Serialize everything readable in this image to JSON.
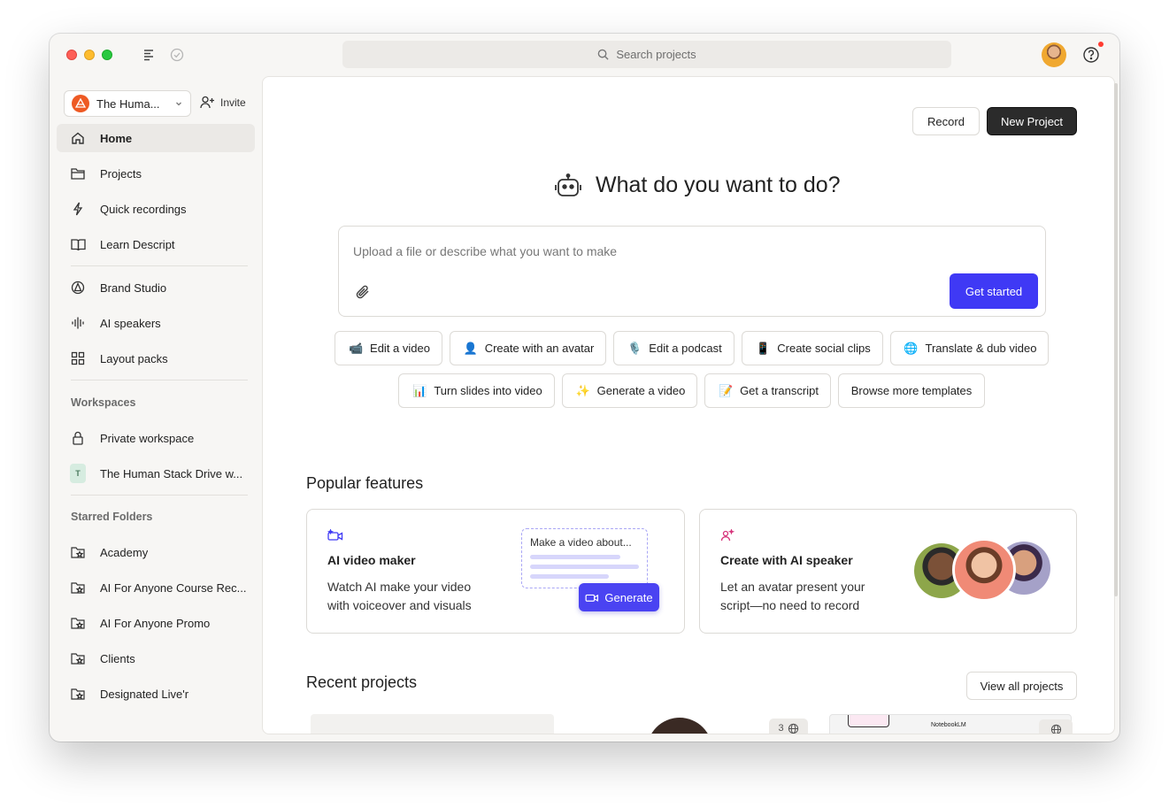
{
  "titlebar": {
    "search_placeholder": "Search projects"
  },
  "sidebar": {
    "workspace_name": "The Huma...",
    "invite_label": "Invite",
    "nav_items": [
      {
        "label": "Home",
        "icon": "home-icon",
        "active": true
      },
      {
        "label": "Projects",
        "icon": "folder-icon"
      },
      {
        "label": "Quick recordings",
        "icon": "lightning-icon"
      },
      {
        "label": "Learn Descript",
        "icon": "book-icon"
      }
    ],
    "tool_items": [
      {
        "label": "Brand Studio",
        "icon": "brand-icon"
      },
      {
        "label": "AI speakers",
        "icon": "waveform-icon"
      },
      {
        "label": "Layout packs",
        "icon": "grid-icon"
      }
    ],
    "workspaces_heading": "Workspaces",
    "workspaces": [
      {
        "label": "Private workspace",
        "icon": "lock-icon"
      },
      {
        "label": "The Human Stack Drive w...",
        "badge": "T"
      }
    ],
    "starred_heading": "Starred Folders",
    "starred": [
      {
        "label": "Academy"
      },
      {
        "label": "AI For Anyone Course Rec..."
      },
      {
        "label": "AI For Anyone Promo"
      },
      {
        "label": "Clients"
      },
      {
        "label": "Designated Live'r"
      }
    ]
  },
  "main": {
    "record_label": "Record",
    "new_project_label": "New Project",
    "hero_title": "What do you want to do?",
    "prompt_placeholder": "Upload a file or describe what you want to make",
    "get_started_label": "Get started",
    "chips_row1": [
      {
        "label": "Edit a video",
        "emoji": "📹"
      },
      {
        "label": "Create with an avatar",
        "emoji": "👤"
      },
      {
        "label": "Edit a podcast",
        "emoji": "🎙️"
      },
      {
        "label": "Create social clips",
        "emoji": "📱"
      },
      {
        "label": "Translate & dub video",
        "emoji": "🌐"
      }
    ],
    "chips_row2": [
      {
        "label": "Turn slides into video",
        "emoji": "📊"
      },
      {
        "label": "Generate a video",
        "emoji": "✨"
      },
      {
        "label": "Get a transcript",
        "emoji": "📝"
      },
      {
        "label": "Browse more templates",
        "emoji": ""
      }
    ],
    "popular_heading": "Popular features",
    "card1": {
      "title": "AI video maker",
      "desc": "Watch AI make your video with voiceover and visuals",
      "mock_text": "Make a video about...",
      "generate_label": "Generate"
    },
    "card2": {
      "title": "Create with AI speaker",
      "desc": "Let an avatar present your script—no need to record"
    },
    "recent_heading": "Recent projects",
    "view_all_label": "View all projects",
    "thumb_count": "3",
    "thumb_brand": "NotebookLM"
  },
  "colors": {
    "accent": "#3f39f5",
    "dark_button": "#2b2b2b",
    "sidebar_bg": "#f7f6f4"
  }
}
